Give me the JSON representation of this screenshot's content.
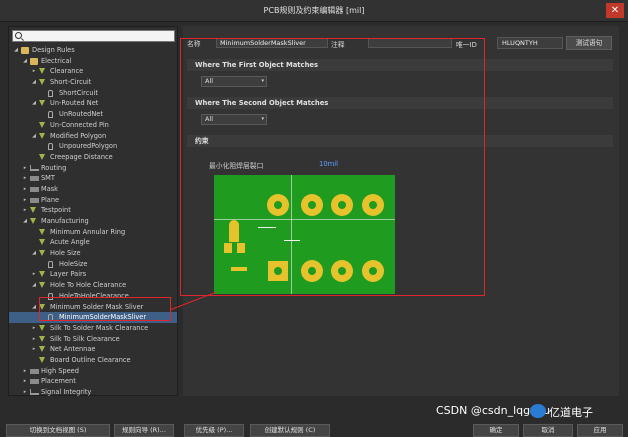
{
  "window": {
    "title": "PCB规则及约束编辑器 [mil]",
    "close_glyph": "✕"
  },
  "search": {
    "value": ""
  },
  "tree": [
    {
      "label": "Design Rules",
      "depth": 0,
      "arrow": "◢",
      "icon": "folder"
    },
    {
      "label": "Electrical",
      "depth": 1,
      "arrow": "◢",
      "icon": "folder"
    },
    {
      "label": "Clearance",
      "depth": 2,
      "arrow": "▸",
      "icon": "rule"
    },
    {
      "label": "Short-Circuit",
      "depth": 2,
      "arrow": "◢",
      "icon": "rule"
    },
    {
      "label": "ShortCircuit",
      "depth": 3,
      "arrow": "",
      "icon": "leaf"
    },
    {
      "label": "Un-Routed Net",
      "depth": 2,
      "arrow": "◢",
      "icon": "rule"
    },
    {
      "label": "UnRoutedNet",
      "depth": 3,
      "arrow": "",
      "icon": "leaf"
    },
    {
      "label": "Un-Connected Pin",
      "depth": 2,
      "arrow": "",
      "icon": "rule"
    },
    {
      "label": "Modified Polygon",
      "depth": 2,
      "arrow": "◢",
      "icon": "rule"
    },
    {
      "label": "UnpouredPolygon",
      "depth": 3,
      "arrow": "",
      "icon": "leaf"
    },
    {
      "label": "Creepage Distance",
      "depth": 2,
      "arrow": "",
      "icon": "rule"
    },
    {
      "label": "Routing",
      "depth": 1,
      "arrow": "▸",
      "icon": "route"
    },
    {
      "label": "SMT",
      "depth": 1,
      "arrow": "▸",
      "icon": "gray"
    },
    {
      "label": "Mask",
      "depth": 1,
      "arrow": "▸",
      "icon": "gray"
    },
    {
      "label": "Plane",
      "depth": 1,
      "arrow": "▸",
      "icon": "gray"
    },
    {
      "label": "Testpoint",
      "depth": 1,
      "arrow": "▸",
      "icon": "rule"
    },
    {
      "label": "Manufacturing",
      "depth": 1,
      "arrow": "◢",
      "icon": "rule"
    },
    {
      "label": "Minimum Annular Ring",
      "depth": 2,
      "arrow": "",
      "icon": "rule"
    },
    {
      "label": "Acute Angle",
      "depth": 2,
      "arrow": "",
      "icon": "rule"
    },
    {
      "label": "Hole Size",
      "depth": 2,
      "arrow": "◢",
      "icon": "rule"
    },
    {
      "label": "HoleSize",
      "depth": 3,
      "arrow": "",
      "icon": "leaf"
    },
    {
      "label": "Layer Pairs",
      "depth": 2,
      "arrow": "▸",
      "icon": "rule"
    },
    {
      "label": "Hole To Hole Clearance",
      "depth": 2,
      "arrow": "◢",
      "icon": "rule"
    },
    {
      "label": "HoleToHoleClearance",
      "depth": 3,
      "arrow": "",
      "icon": "leaf"
    },
    {
      "label": "Minimum Solder Mask Sliver",
      "depth": 2,
      "arrow": "◢",
      "icon": "rule"
    },
    {
      "label": "MinimumSolderMaskSliver",
      "depth": 3,
      "arrow": "",
      "icon": "leaf",
      "selected": true
    },
    {
      "label": "Silk To Solder Mask Clearance",
      "depth": 2,
      "arrow": "▸",
      "icon": "rule"
    },
    {
      "label": "Silk To Silk Clearance",
      "depth": 2,
      "arrow": "▸",
      "icon": "rule"
    },
    {
      "label": "Net Antennae",
      "depth": 2,
      "arrow": "▸",
      "icon": "rule"
    },
    {
      "label": "Board Outline Clearance",
      "depth": 2,
      "arrow": "",
      "icon": "rule"
    },
    {
      "label": "High Speed",
      "depth": 1,
      "arrow": "▸",
      "icon": "gray"
    },
    {
      "label": "Placement",
      "depth": 1,
      "arrow": "▸",
      "icon": "gray"
    },
    {
      "label": "Signal Integrity",
      "depth": 1,
      "arrow": "▸",
      "icon": "route"
    }
  ],
  "editor": {
    "name_label": "名称",
    "name_value": "MinimumSolderMaskSliver",
    "comment_label": "注释",
    "comment_value": "",
    "uid_label": "唯一ID",
    "uid_value": "HLUQNTYH",
    "test_button": "测试语句",
    "first_header": "Where The First Object Matches",
    "first_select": "All",
    "second_header": "Where The Second Object Matches",
    "second_select": "All",
    "constraints_header": "约束",
    "constraint_label": "最小化阻焊层裂口",
    "constraint_value": "10mil",
    "dropdown_glyph": "▾"
  },
  "buttons": {
    "switch_view": "切换到文档视图 (S)",
    "rule_wizard": "规则向导 (R)...",
    "priority": "优先级 (P)...",
    "create_default": "创建默认规则 (C)",
    "ok": "确定",
    "cancel": "取消",
    "apply": "应用"
  },
  "watermark": {
    "text": "CSDN @csdn_lqgxyu",
    "logo_text": "亿道电子"
  },
  "colors": {
    "pcb_board": "#1f9b1f",
    "pad": "#e6c32d",
    "highlight_box": "#e0262b",
    "selection": "#3e5f86",
    "value_blue": "#5aa0ff"
  }
}
